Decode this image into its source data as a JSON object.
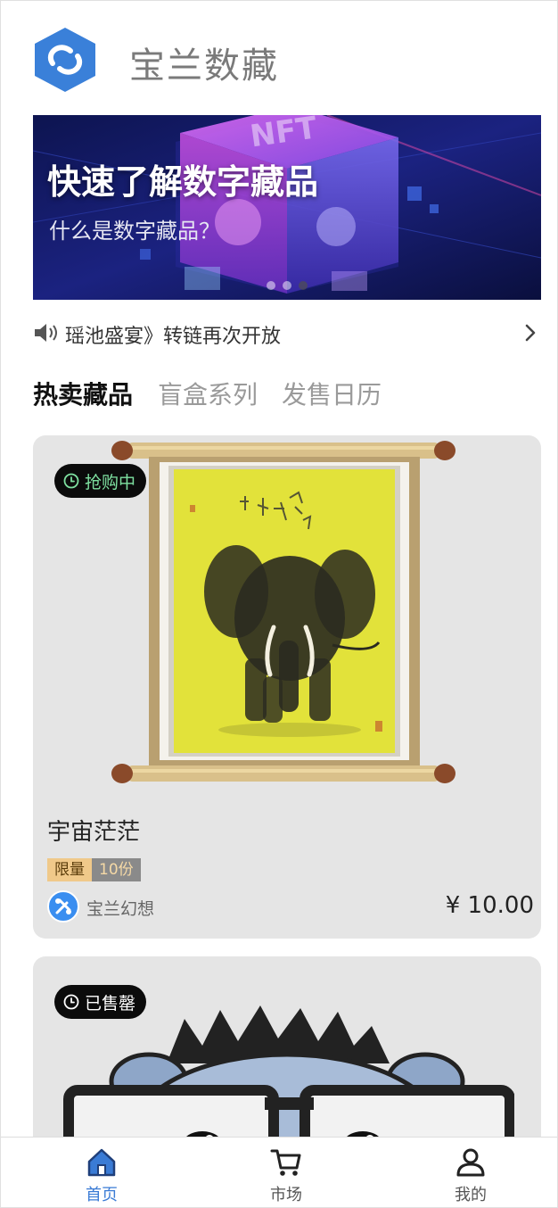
{
  "app": {
    "title": "宝兰数藏",
    "brand_color": "#3a80d9"
  },
  "banner": {
    "title": "快速了解数字藏品",
    "subtitle": "什么是数字藏品？",
    "slide_count": 2,
    "active_slide": 2
  },
  "notice": {
    "text": "瑶池盛宴》转链再次开放",
    "icon": "speaker-icon",
    "arrow_icon": "chevron-right-icon"
  },
  "tabs": [
    {
      "label": "热卖藏品",
      "active": true
    },
    {
      "label": "盲盒系列",
      "active": false
    },
    {
      "label": "发售日历",
      "active": false
    }
  ],
  "cards": [
    {
      "status": "抢购中",
      "status_color": "#7ee0a0",
      "name": "宇宙茫茫",
      "edition_label": "限量",
      "edition_count": "10份",
      "creator": "宝兰幻想",
      "price": "¥ 10.00"
    },
    {
      "status": "已售罄",
      "status_color": "#ffffff"
    }
  ],
  "nav": [
    {
      "label": "首页",
      "icon": "home-icon",
      "active": true
    },
    {
      "label": "市场",
      "icon": "cart-icon",
      "active": false
    },
    {
      "label": "我的",
      "icon": "user-icon",
      "active": false
    }
  ]
}
